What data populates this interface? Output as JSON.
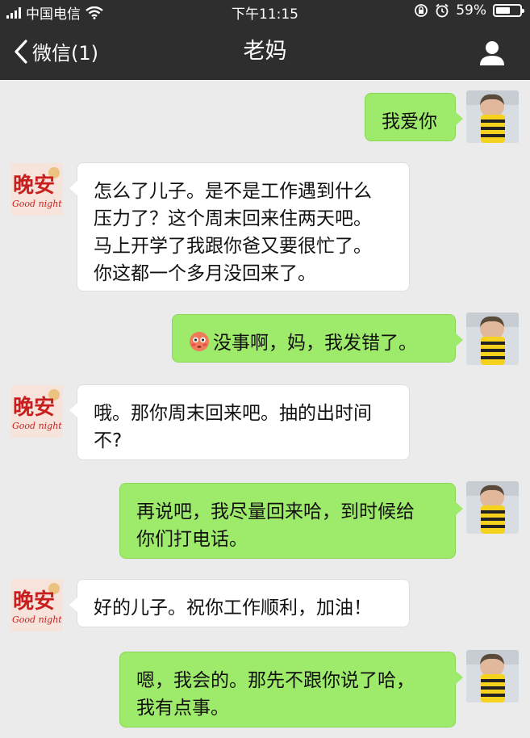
{
  "status_bar": {
    "carrier": "中国电信",
    "time": "下午11:15",
    "battery_percent": "59%",
    "battery_level": 0.59,
    "icons": [
      "signal-icon",
      "wifi-icon",
      "rotation-lock-icon",
      "alarm-icon",
      "battery-icon"
    ]
  },
  "nav": {
    "back_label": "微信(1)",
    "title": "老妈",
    "icons": [
      "back-chevron-icon",
      "user-profile-icon"
    ]
  },
  "avatars": {
    "mom_text": "晚安",
    "mom_subtext": "Good night",
    "mom_colors": {
      "background": "#f6e3dc",
      "text": "#c81e1e",
      "accent": "#e8b45a"
    },
    "self_colors": {
      "background": "#d7dde2",
      "hair": "#5a4a3a",
      "face": "#e2b89c",
      "stripes": "#f5d21d"
    }
  },
  "messages": [
    {
      "sender": "self",
      "lines": [
        "我爱你"
      ]
    },
    {
      "sender": "mom",
      "lines": [
        "怎么了儿子。是不是工作遇到什么",
        "压力了？这个周末回来住两天吧。",
        "马上开学了我跟你爸又要很忙了。",
        "你这都一个多月没回来了。"
      ]
    },
    {
      "sender": "self",
      "emoji": "flushed-face-icon",
      "lines": [
        "没事啊，妈，我发错了。"
      ]
    },
    {
      "sender": "mom",
      "lines": [
        "哦。那你周末回来吧。抽的出时间",
        "不?"
      ]
    },
    {
      "sender": "self",
      "lines": [
        "再说吧，我尽量回来哈，到时候给",
        "你们打电话。"
      ]
    },
    {
      "sender": "mom",
      "lines": [
        "好的儿子。祝你工作顺利，加油！"
      ]
    },
    {
      "sender": "self",
      "lines": [
        "嗯，我会的。那先不跟你说了哈，",
        "我有点事。"
      ]
    }
  ],
  "colors": {
    "bar_background": "#2e2e2e",
    "chat_background": "#ebebeb",
    "outgoing_bubble": "#9eea6a",
    "incoming_bubble": "#ffffff"
  }
}
